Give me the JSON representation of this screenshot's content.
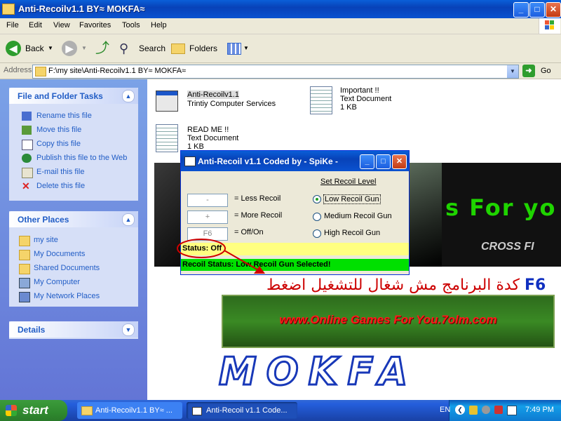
{
  "window": {
    "title": "Anti-Recoilv1.1 BY≈ MOKFA≈",
    "buttons": {
      "minimize": "_",
      "maximize": "□",
      "close": "✕"
    }
  },
  "menu": [
    "File",
    "Edit",
    "View",
    "Favorites",
    "Tools",
    "Help"
  ],
  "toolbar": {
    "back": "Back",
    "search": "Search",
    "folders": "Folders"
  },
  "address": {
    "label": "Address",
    "value": "F:\\my site\\Anti-Recoilv1.1 BY≈ MOKFA≈",
    "go": "Go"
  },
  "left_pane": {
    "file_tasks": {
      "title": "File and Folder Tasks",
      "items": [
        "Rename this file",
        "Move this file",
        "Copy this file",
        "Publish this file to the Web",
        "E-mail this file",
        "Delete this file"
      ]
    },
    "other_places": {
      "title": "Other Places",
      "items": [
        "my site",
        "My Documents",
        "Shared Documents",
        "My Computer",
        "My Network Places"
      ]
    },
    "details": {
      "title": "Details"
    }
  },
  "files": [
    {
      "name": "Anti-Recoilv1.1",
      "line2": "Trintiy Computer Services",
      "line3": ""
    },
    {
      "name": "Important !!",
      "line2": "Text Document",
      "line3": "1 KB"
    },
    {
      "name": "READ ME !!",
      "line2": "Text Document",
      "line3": "1 KB"
    }
  ],
  "content": {
    "banner_text": "s For yo",
    "crossfire": "CROSS FI",
    "arabic_text": "كدة البرنامج مش شغال للتشغيل اضغط",
    "arabic_key": "F6",
    "site_text": "www.Online Games For You.7olm.com",
    "mokfa": "MOKFA"
  },
  "dialog": {
    "title": "Anti-Recoil v1.1 Coded by - SpiKe -",
    "keys": [
      {
        "key": "-",
        "label": "= Less Recoil"
      },
      {
        "key": "+",
        "label": "= More Recoil"
      },
      {
        "key": "F6",
        "label": "= Off/On"
      }
    ],
    "recoil_heading": "Set Recoil Level",
    "options": [
      "Low Recoil Gun",
      "Medium Recoil Gun",
      "High Recoil Gun"
    ],
    "selected_option": 0,
    "status": "Status: Off",
    "recoil_status": "Recoil Status: Low Recoil Gun Selected!"
  },
  "taskbar": {
    "start": "start",
    "items": [
      "Anti-Recoilv1.1 BY≈ ...",
      "Anti-Recoil v1.1 Code..."
    ],
    "lang": "EN",
    "time": "7:49 PM"
  }
}
